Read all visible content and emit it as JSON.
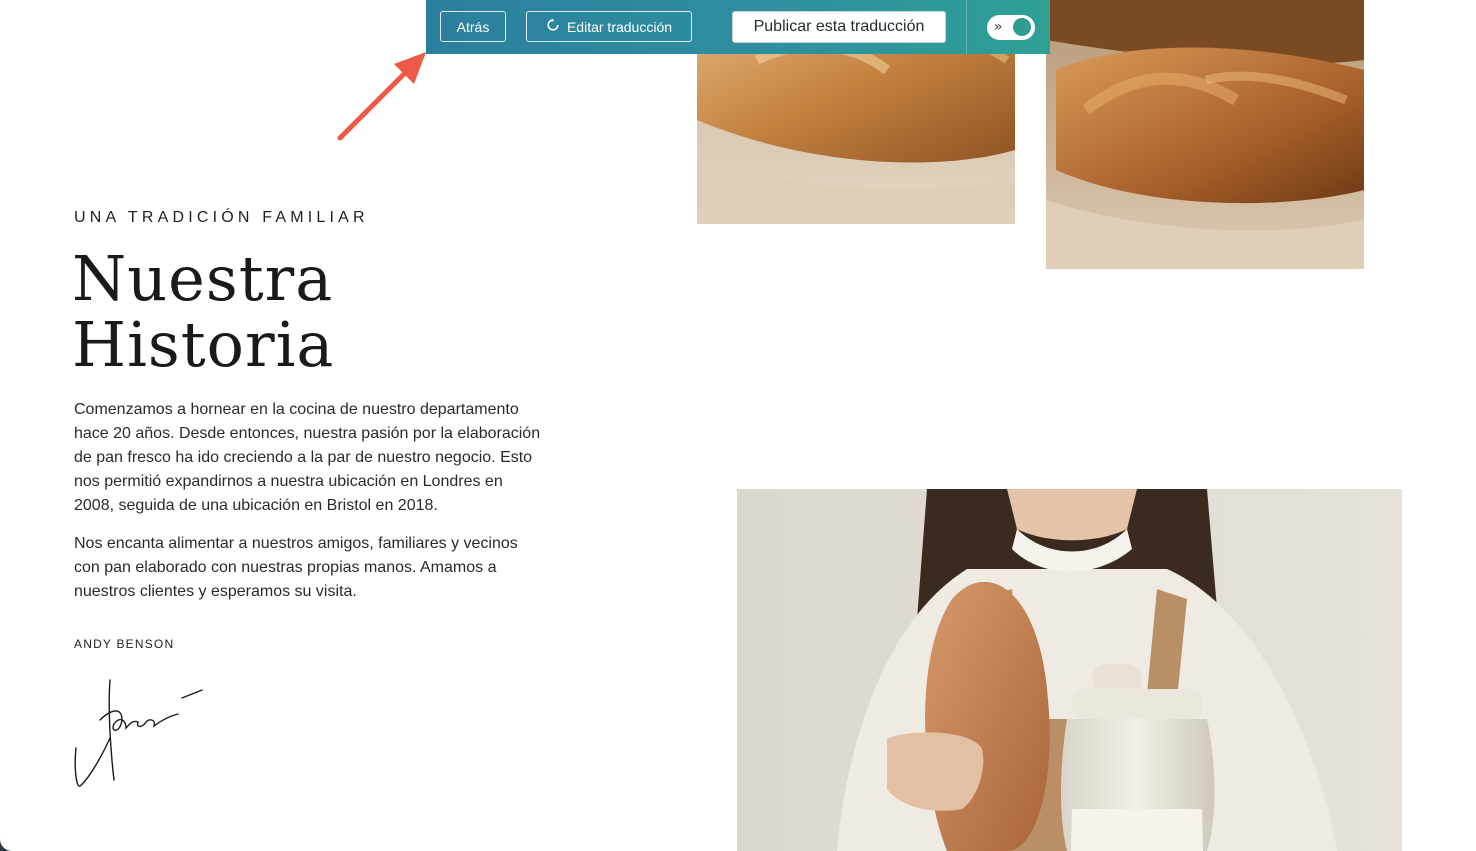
{
  "toolbar": {
    "back_label": "Atrás",
    "edit_label": "Editar traducción",
    "publish_label": "Publicar esta traducción",
    "toggle_icon": "»",
    "toggle_state": "on",
    "colors": {
      "gradient_start": "#2b7f9e",
      "gradient_end": "#2fa096",
      "toggle_knob": "#2e9d8e"
    }
  },
  "annotation": {
    "arrow_color": "#ee5a45"
  },
  "content": {
    "eyebrow": "UNA TRADICIÓN FAMILIAR",
    "heading_line1": "Nuestra",
    "heading_line2": "Historia",
    "paragraph1": "Comenzamos a hornear en la cocina de nuestro departamento hace 20 años. Desde entonces, nuestra pasión por la elaboración de pan fresco ha ido creciendo a la par de nuestro negocio. Esto nos permitió expandirnos a nuestra ubicación en Londres en 2008, seguida de una ubicación en Bristol en 2018.",
    "paragraph2": "Nos encanta alimentar a nuestros amigos, familiares y vecinos con pan elaborado con nuestras propias manos. Amamos a nuestros clientes y esperamos su visita.",
    "author": "ANDY BENSON"
  },
  "images": {
    "bread_left": "baguette-closeup-photo",
    "bread_right": "baguette-stack-photo",
    "baker": "baker-holding-bread-and-jar-photo"
  }
}
